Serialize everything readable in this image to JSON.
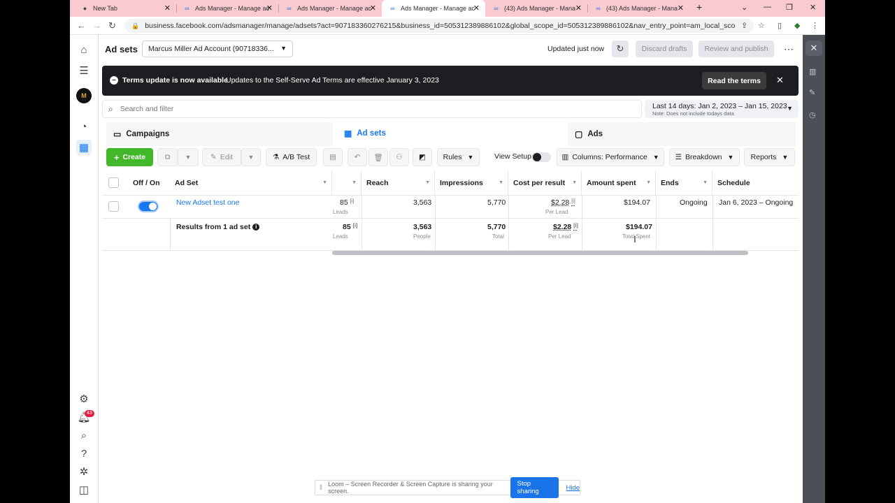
{
  "browser": {
    "tabs": [
      {
        "title": "New Tab",
        "icon": "chrome-icon"
      },
      {
        "title": "Ads Manager - Manage ac",
        "icon": "meta-icon"
      },
      {
        "title": "Ads Manager - Manage ac",
        "icon": "meta-icon"
      },
      {
        "title": "Ads Manager - Manage ac",
        "icon": "meta-icon"
      },
      {
        "title": "(43) Ads Manager - Mana",
        "icon": "meta-icon"
      },
      {
        "title": "(43) Ads Manager - Mana",
        "icon": "meta-icon"
      }
    ],
    "active_tab_index": 3,
    "url": "business.facebook.com/adsmanager/manage/adsets?act=907183360276215&business_id=505312389886102&global_scope_id=505312389886102&nav_entry_point=am_local_scope_selecto..."
  },
  "left_nav": {
    "avatar_text": "M",
    "notification_count": "43"
  },
  "header": {
    "title": "Ad sets",
    "account": "Marcus Miller Ad Account (90718336...",
    "updated": "Updated just now",
    "discard_label": "Discard drafts",
    "review_label": "Review and publish"
  },
  "banner": {
    "title": "Terms update is now available",
    "text": "Updates to the Self-Serve Ad Terms are effective January 3, 2023",
    "button": "Read the terms"
  },
  "search": {
    "placeholder": "Search and filter"
  },
  "date": {
    "range": "Last 14 days: Jan 2, 2023 – Jan 15, 2023",
    "note": "Note: Does not include todays data"
  },
  "level_tabs": {
    "campaigns": "Campaigns",
    "adsets": "Ad sets",
    "ads": "Ads"
  },
  "actions": {
    "create": "Create",
    "edit": "Edit",
    "abtest": "A/B Test",
    "rules": "Rules",
    "view_setup": "View Setup",
    "columns": "Columns: Performance",
    "breakdown": "Breakdown",
    "reports": "Reports"
  },
  "table": {
    "headers": {
      "onoff": "Off / On",
      "adset": "Ad Set",
      "reach": "Reach",
      "impressions": "Impressions",
      "cpr": "Cost per result",
      "spent": "Amount spent",
      "ends": "Ends",
      "schedule": "Schedule"
    },
    "row": {
      "name": "New Adset test one",
      "results": "85",
      "results_sub": "Leads",
      "reach": "3,563",
      "impressions": "5,770",
      "cpr": "$2.28",
      "cpr_sub": "Per Lead",
      "spent": "$194.07",
      "ends": "Ongoing",
      "schedule": "Jan 6, 2023 – Ongoing",
      "toggle_on": true
    },
    "summary": {
      "label": "Results from 1 ad set",
      "results": "85",
      "results_sub": "Leads",
      "reach": "3,563",
      "reach_sub": "People",
      "impressions": "5,770",
      "impressions_sub": "Total",
      "cpr": "$2.28",
      "cpr_sub": "Per Lead",
      "spent": "$194.07",
      "spent_sub": "Total Spent"
    }
  },
  "loom": {
    "text": "Loom – Screen Recorder & Screen Capture is sharing your screen.",
    "stop": "Stop sharing",
    "hide": "Hide"
  },
  "colors": {
    "brand_blue": "#1877f2",
    "create_green": "#42b72a",
    "tab_strip": "#f9cbd0",
    "banner_bg": "#1c1e21"
  }
}
